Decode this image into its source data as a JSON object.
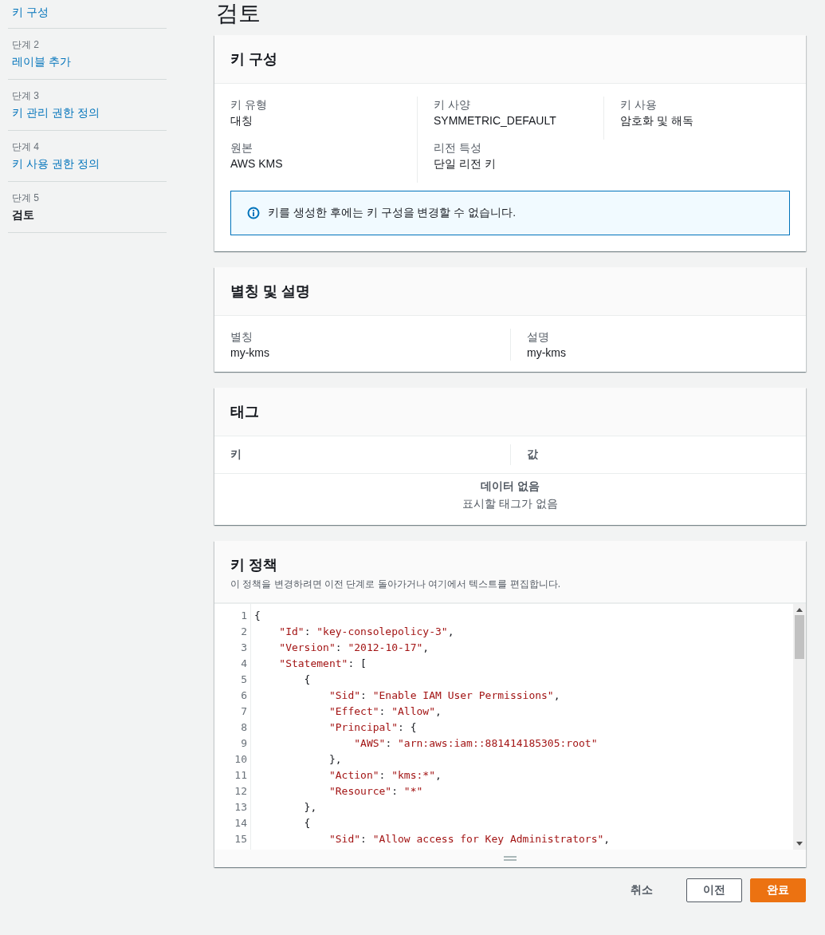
{
  "sidebar": {
    "steps": [
      {
        "title": "키 구성",
        "selected": false
      },
      {
        "label": "단계 2",
        "title": "레이블 추가",
        "selected": false
      },
      {
        "label": "단계 3",
        "title": "키 관리 권한 정의",
        "selected": false
      },
      {
        "label": "단계 4",
        "title": "키 사용 권한 정의",
        "selected": false
      },
      {
        "label": "단계 5",
        "title": "검토",
        "selected": true
      }
    ]
  },
  "page_title": "검토",
  "key_config": {
    "title": "키 구성",
    "columns": [
      [
        {
          "label": "키 유형",
          "value": "대칭"
        },
        {
          "label": "원본",
          "value": "AWS KMS"
        }
      ],
      [
        {
          "label": "키 사양",
          "value": "SYMMETRIC_DEFAULT"
        },
        {
          "label": "리전 특성",
          "value": "단일 리전 키"
        }
      ],
      [
        {
          "label": "키 사용",
          "value": "암호화 및 해독"
        }
      ]
    ],
    "info": "키를 생성한 후에는 키 구성을 변경할 수 없습니다."
  },
  "alias": {
    "title": "별칭 및 설명",
    "fields": [
      {
        "label": "별칭",
        "value": "my-kms"
      },
      {
        "label": "설명",
        "value": "my-kms"
      }
    ]
  },
  "tags": {
    "title": "태그",
    "columns": [
      "키",
      "값"
    ],
    "empty_title": "데이터 없음",
    "empty_text": "표시할 태그가 없음"
  },
  "policy": {
    "title": "키 정책",
    "description": "이 정책을 변경하려면 이전 단계로 돌아가거나 여기에서 텍스트를 편집합니다.",
    "line_numbers": [
      "1",
      "2",
      "3",
      "4",
      "5",
      "6",
      "7",
      "8",
      "9",
      "10",
      "11",
      "12",
      "13",
      "14",
      "15"
    ],
    "lines": [
      "{",
      "    \"Id\": \"key-consolepolicy-3\",",
      "    \"Version\": \"2012-10-17\",",
      "    \"Statement\": [",
      "        {",
      "            \"Sid\": \"Enable IAM User Permissions\",",
      "            \"Effect\": \"Allow\",",
      "            \"Principal\": {",
      "                \"AWS\": \"arn:aws:iam::881414185305:root\"",
      "            },",
      "            \"Action\": \"kms:*\",",
      "            \"Resource\": \"*\"",
      "        },",
      "        {",
      "            \"Sid\": \"Allow access for Key Administrators\","
    ]
  },
  "actions": [
    {
      "label": "취소",
      "kind": "link"
    },
    {
      "label": "이전",
      "kind": "secondary"
    },
    {
      "label": "완료",
      "kind": "primary"
    }
  ]
}
